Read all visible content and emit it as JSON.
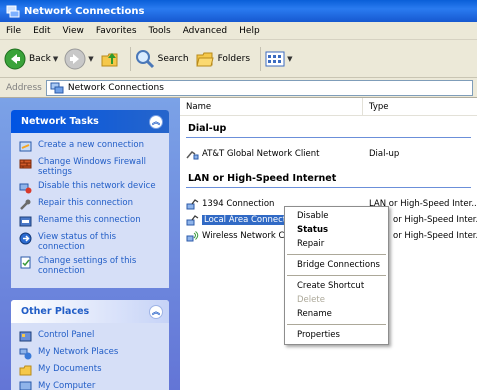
{
  "window": {
    "title": "Network Connections"
  },
  "menubar": {
    "items": [
      "File",
      "Edit",
      "View",
      "Favorites",
      "Tools",
      "Advanced",
      "Help"
    ]
  },
  "toolbar": {
    "back_label": "Back",
    "search_label": "Search",
    "folders_label": "Folders"
  },
  "address": {
    "label": "Address",
    "value": "Network Connections"
  },
  "taskpane": {
    "network_tasks": {
      "title": "Network Tasks",
      "items": [
        {
          "label": "Create a new connection",
          "icon": "new-connection-icon"
        },
        {
          "label": "Change Windows Firewall settings",
          "icon": "firewall-icon"
        },
        {
          "label": "Disable this network device",
          "icon": "disable-device-icon"
        },
        {
          "label": "Repair this connection",
          "icon": "repair-icon"
        },
        {
          "label": "Rename this connection",
          "icon": "rename-icon"
        },
        {
          "label": "View status of this connection",
          "icon": "status-icon"
        },
        {
          "label": "Change settings of this connection",
          "icon": "settings-icon"
        }
      ]
    },
    "other_places": {
      "title": "Other Places",
      "items": [
        {
          "label": "Control Panel",
          "icon": "control-panel-icon"
        },
        {
          "label": "My Network Places",
          "icon": "network-places-icon"
        },
        {
          "label": "My Documents",
          "icon": "documents-folder-icon"
        },
        {
          "label": "My Computer",
          "icon": "computer-icon"
        }
      ]
    }
  },
  "list": {
    "columns": {
      "name": "Name",
      "type": "Type"
    },
    "groups": [
      {
        "title": "Dial-up",
        "rows": [
          {
            "name": "AT&T Global Network Client",
            "type": "Dial-up"
          }
        ]
      },
      {
        "title": "LAN or High-Speed Internet",
        "rows": [
          {
            "name": "1394 Connection",
            "type": "LAN or High-Speed Inter..."
          },
          {
            "name": "Local Area Connection",
            "type": "or High-Speed Inter..."
          },
          {
            "name": "Wireless Network Conn",
            "type": "or High-Speed Inter..."
          }
        ]
      }
    ]
  },
  "context_menu": {
    "disable": "Disable",
    "status": "Status",
    "repair": "Repair",
    "bridge": "Bridge Connections",
    "shortcut": "Create Shortcut",
    "delete": "Delete",
    "rename": "Rename",
    "properties": "Properties"
  },
  "colors": {
    "title_bar": "#0a5fd8",
    "task_pane": "#6f8de0",
    "selection": "#316ac5"
  }
}
